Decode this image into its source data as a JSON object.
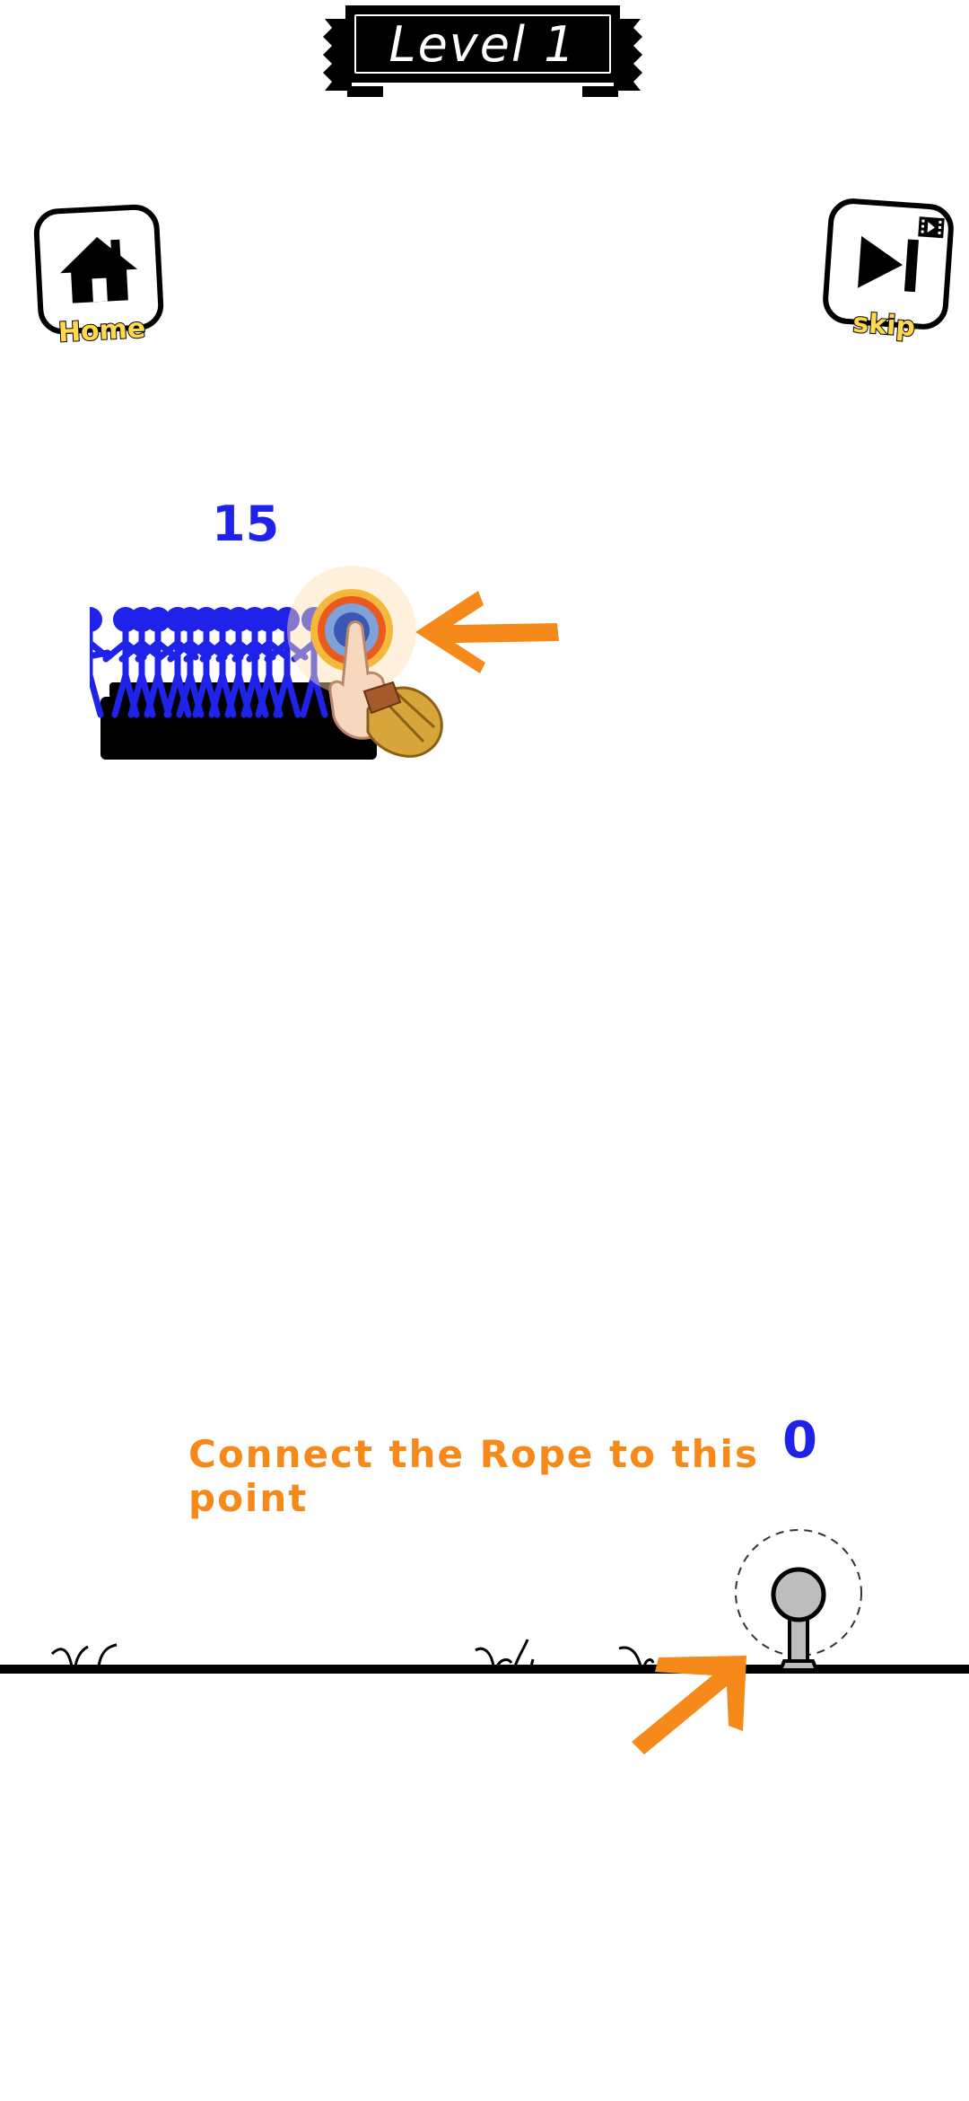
{
  "header": {
    "level_label": "Level 1"
  },
  "buttons": {
    "home_label": "Home",
    "skip_label": "skip"
  },
  "crowd": {
    "count": "15"
  },
  "target": {
    "count": "0"
  },
  "instruction": "Connect the Rope to this point",
  "colors": {
    "stickman": "#1f22e8",
    "arrow": "#f58a1a",
    "label_yellow": "#ffd94a",
    "ground": "#000000"
  },
  "icons": [
    "home-icon",
    "skip-next-icon",
    "video-ad-icon",
    "tap-hand-icon",
    "arrow-left-icon",
    "arrow-up-right-icon",
    "rope-anchor-icon"
  ]
}
